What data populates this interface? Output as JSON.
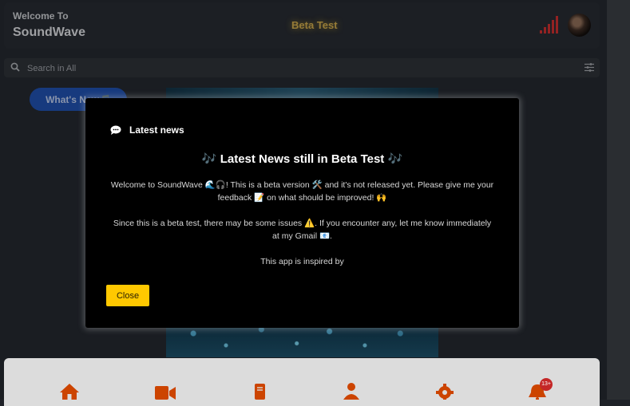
{
  "header": {
    "welcome_small": "Welcome To",
    "app_name": "SoundWave",
    "beta_label": "Beta Test",
    "signal_color": "#c62e2e"
  },
  "search": {
    "placeholder": "Search in All"
  },
  "whats_new": {
    "label": "What's New🎵"
  },
  "modal": {
    "heading": "Latest news",
    "title": "🎶 Latest News still in Beta Test 🎶",
    "paragraph1": "Welcome to SoundWave 🌊🎧! This is a beta version 🛠️ and it's not released yet. Please give me your feedback 📝 on what should be improved! 🙌",
    "paragraph2": "Since this is a beta test, there may be some issues ⚠️. If you encounter any, let me know immediately at my Gmail 📧.",
    "paragraph3": "This app is inspired by",
    "close_label": "Close",
    "accent": "#ffc800"
  },
  "bottom_nav": {
    "icon_color": "#cc4400",
    "items": [
      {
        "icon": "home-icon"
      },
      {
        "icon": "video-icon"
      },
      {
        "icon": "book-icon"
      },
      {
        "icon": "user-icon"
      },
      {
        "icon": "gear-icon"
      },
      {
        "icon": "bell-icon"
      }
    ],
    "notification_badge": "13+"
  }
}
